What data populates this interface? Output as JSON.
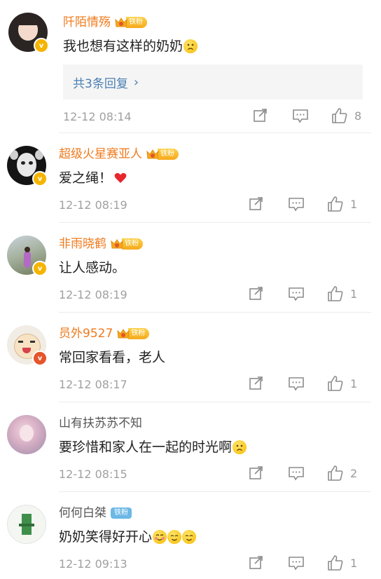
{
  "comments": [
    {
      "name": "阡陌情殇",
      "fan_label": "铁粉",
      "text": "我也想有这样的奶奶",
      "emoji": [
        "sad-face-emoji"
      ],
      "reply_summary": "共3条回复",
      "time": "12-12 08:14",
      "likes": "8"
    },
    {
      "name": "超级火星赛亚人",
      "fan_label": "铁粉",
      "text": "爱之绳！",
      "emoji": [
        "red-heart-emoji"
      ],
      "time": "12-12 08:19",
      "likes": "1"
    },
    {
      "name": "非雨晓鹤",
      "fan_label": "铁粉",
      "text": "让人感动。",
      "emoji": [],
      "time": "12-12 08:19",
      "likes": "1"
    },
    {
      "name": "员外9527",
      "fan_label": "铁粉",
      "text": "常回家看看，老人",
      "emoji": [],
      "time": "12-12 08:17",
      "likes": "1"
    },
    {
      "name": "山有扶苏苏不知",
      "text": "要珍惜和家人在一起的时光啊",
      "emoji": [
        "sad-face-emoji"
      ],
      "time": "12-12 08:15",
      "likes": "2"
    },
    {
      "name": "何何白桀",
      "fan_label": "铁粉",
      "text": "奶奶笑得好开心",
      "emoji": [
        "blush-face-emoji",
        "smile-face-emoji",
        "smile-face-emoji"
      ],
      "time": "12-12 09:13",
      "likes": "1"
    }
  ],
  "icons": {
    "repost": "share-icon",
    "comment": "comment-icon",
    "like": "thumbs-up-icon",
    "verified": "verified-v-badge"
  },
  "colors": {
    "username_orange": "#f07a1d",
    "username_gray": "#555555",
    "reply_link": "#4a7fb2",
    "meta_gray": "#a0a0a0",
    "fan_badge": "#f6a91c",
    "fan_badge_plain": "#6cb8e6"
  }
}
